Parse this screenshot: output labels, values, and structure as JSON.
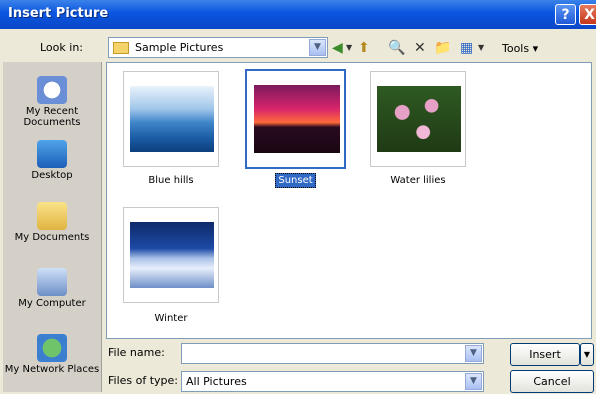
{
  "window": {
    "title": "Insert Picture",
    "help_label": "?",
    "close_label": "X"
  },
  "toolbar": {
    "lookin_label": "Look in:",
    "lookin_value": "Sample Pictures",
    "dropdown_arrow": "▼",
    "tools_label": "Tools ▾",
    "back_glyph": "◀",
    "up_glyph": "⬆",
    "search_glyph": "🔍",
    "delete_glyph": "✕",
    "newfolder_glyph": "📁",
    "views_glyph": "▦"
  },
  "places": [
    {
      "label": "My Recent Documents"
    },
    {
      "label": "Desktop"
    },
    {
      "label": "My Documents"
    },
    {
      "label": "My Computer"
    },
    {
      "label": "My Network Places"
    }
  ],
  "files": [
    {
      "name": "Blue hills"
    },
    {
      "name": "Sunset",
      "selected": true
    },
    {
      "name": "Water lilies"
    },
    {
      "name": "Winter"
    }
  ],
  "form": {
    "filename_label": "File name:",
    "filename_value": "",
    "filetype_label": "Files of type:",
    "filetype_value": "All Pictures",
    "insert_label": "Insert",
    "cancel_label": "Cancel"
  },
  "colors": {
    "titlebar": "#0a55e0",
    "selection": "#316ac5"
  }
}
